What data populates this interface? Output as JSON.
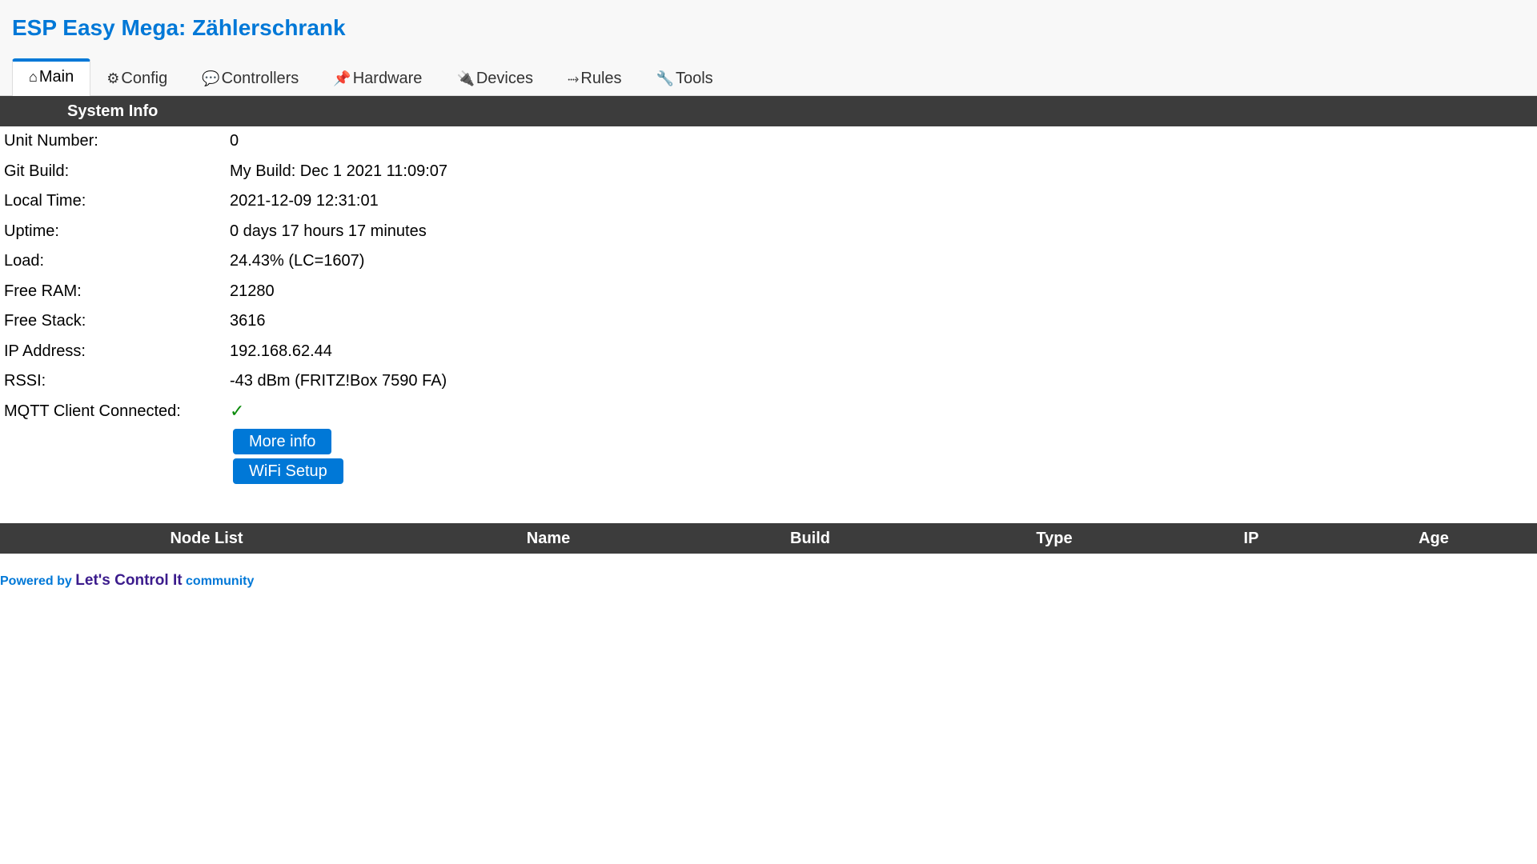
{
  "app": {
    "title": "ESP Easy Mega: Zählerschrank"
  },
  "tabs": [
    {
      "icon": "⌂",
      "icon_name": "home-icon",
      "label": "Main",
      "active": true
    },
    {
      "icon": "⚙",
      "icon_name": "gear-icon",
      "label": "Config",
      "active": false
    },
    {
      "icon": "💬",
      "icon_name": "speech-bubble-icon",
      "label": "Controllers",
      "active": false
    },
    {
      "icon": "📌",
      "icon_name": "pushpin-icon",
      "label": "Hardware",
      "active": false
    },
    {
      "icon": "🔌",
      "icon_name": "plug-icon",
      "label": "Devices",
      "active": false
    },
    {
      "icon": "⤑",
      "icon_name": "arrow-right-icon",
      "label": "Rules",
      "active": false
    },
    {
      "icon": "🔧",
      "icon_name": "wrench-icon",
      "label": "Tools",
      "active": false
    }
  ],
  "system_info": {
    "heading": "System Info",
    "rows": [
      {
        "key": "Unit Number:",
        "value": "0"
      },
      {
        "key": "Git Build:",
        "value": "My Build: Dec 1 2021 11:09:07"
      },
      {
        "key": "Local Time:",
        "value": "2021-12-09 12:31:01"
      },
      {
        "key": "Uptime:",
        "value": "0 days 17 hours 17 minutes"
      },
      {
        "key": "Load:",
        "value": "24.43% (LC=1607)"
      },
      {
        "key": "Free RAM:",
        "value": "21280"
      },
      {
        "key": "Free Stack:",
        "value": "3616"
      },
      {
        "key": "IP Address:",
        "value": "192.168.62.44"
      },
      {
        "key": "RSSI:",
        "value": "-43 dBm (FRITZ!Box 7590 FA)"
      },
      {
        "key": "MQTT Client Connected:",
        "value": "✓"
      }
    ],
    "buttons": {
      "more_info": "More info",
      "wifi_setup": "WiFi Setup"
    }
  },
  "node_list": {
    "columns": [
      "Node List",
      "Name",
      "Build",
      "Type",
      "IP",
      "Age"
    ]
  },
  "footer": {
    "prefix": "Powered by",
    "link": "Let's Control It",
    "suffix": "community"
  },
  "colors": {
    "accent": "#0078d7",
    "bar_bg": "#3c3c3c",
    "check": "#0a8a0a",
    "footer_link": "#3b1b8c"
  }
}
